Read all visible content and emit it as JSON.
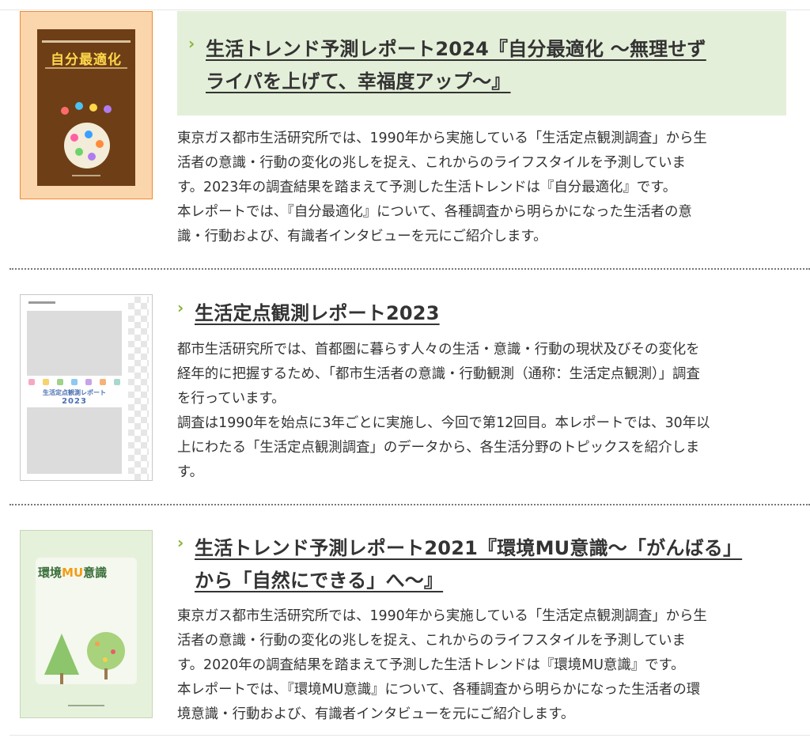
{
  "entries": [
    {
      "title_line1": "生活トレンド予測レポート2024『自分最適化 〜無理せず",
      "title_line2": "ライパを上げて、幸福度アップ〜』",
      "desc_lines": [
        "東京ガス都市生活研究所では、1990年から実施している「生活定点観測調査」から生",
        "活者の意識・行動の変化の兆しを捉え、これからのライフスタイルを予測していま",
        "す。2023年の調査結果を踏まえて予測した生活トレンドは『自分最適化』です。",
        "本レポートでは、『自分最適化』について、各種調査から明らかになった生活者の意",
        "識・行動および、有識者インタビューを元にご紹介します。"
      ],
      "cover": {
        "main_label": "自分最適化",
        "bg": "#fbd6ad",
        "accent": "#f08a30",
        "inner": "#6e3e17"
      }
    },
    {
      "title_line1": "生活定点観測レポート2023",
      "desc_lines": [
        "都市生活研究所では、首都圏に暮らす人々の生活・意識・行動の現状及びその変化を",
        "経年的に把握するため、「都市生活者の意識・行動観測（通称：生活定点観測）」調査",
        "を行っています。",
        "調査は1990年を始点に3年ごとに実施し、今回で第12回目。本レポートでは、30年以",
        "上にわたる「生活定点観測調査」のデータから、各生活分野のトピックスを紹介しま",
        "す。"
      ],
      "cover": {
        "main_label": "生活定点観測レポート",
        "year": "2023"
      }
    },
    {
      "title_line1": "生活トレンド予測レポート2021『環境MU意識〜「がんばる」",
      "title_line2": "から「自然にできる」へ〜』",
      "desc_lines": [
        "東京ガス都市生活研究所では、1990年から実施している「生活定点観測調査」から生",
        "活者の意識・行動の変化の兆しを捉え、これからのライフスタイルを予測していま",
        "す。2020年の調査結果を踏まえて予測した生活トレンドは『環境MU意識』です。",
        "本レポートでは、『環境MU意識』について、各種調査から明らかになった生活者の環",
        "境意識・行動および、有識者インタビューを元にご紹介します。"
      ],
      "cover": {
        "label_a": "環境",
        "label_mu": "MU",
        "label_b": "意識",
        "bg": "#e6f1dc"
      }
    }
  ],
  "colors": {
    "chevron": "#8ab43a",
    "highlight_bg": "#e4efd9",
    "text": "#333333"
  }
}
